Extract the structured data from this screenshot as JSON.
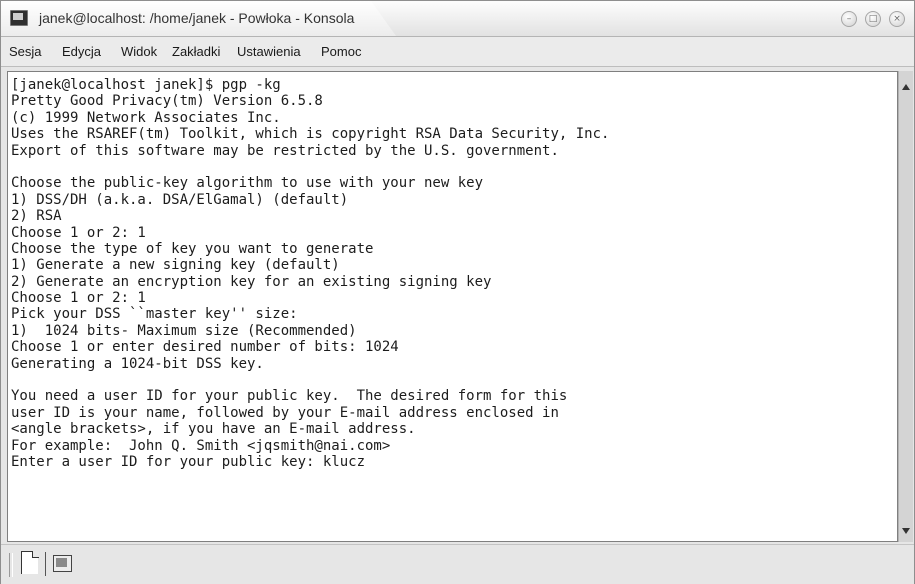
{
  "window": {
    "title": "janek@localhost: /home/janek - Powłoka - Konsola",
    "controls": {
      "minimize": "–",
      "maximize": "□",
      "close": "×"
    }
  },
  "menu": {
    "items": [
      "Sesja",
      "Edycja",
      "Widok",
      "Zakładki",
      "Ustawienia",
      "Pomoc"
    ]
  },
  "terminal": {
    "lines": [
      "[janek@localhost janek]$ pgp -kg",
      "Pretty Good Privacy(tm) Version 6.5.8",
      "(c) 1999 Network Associates Inc.",
      "Uses the RSAREF(tm) Toolkit, which is copyright RSA Data Security, Inc.",
      "Export of this software may be restricted by the U.S. government.",
      "",
      "Choose the public-key algorithm to use with your new key",
      "1) DSS/DH (a.k.a. DSA/ElGamal) (default)",
      "2) RSA",
      "Choose 1 or 2: 1",
      "Choose the type of key you want to generate",
      "1) Generate a new signing key (default)",
      "2) Generate an encryption key for an existing signing key",
      "Choose 1 or 2: 1",
      "Pick your DSS ``master key'' size:",
      "1)  1024 bits- Maximum size (Recommended)",
      "Choose 1 or enter desired number of bits: 1024",
      "Generating a 1024-bit DSS key.",
      "",
      "You need a user ID for your public key.  The desired form for this",
      "user ID is your name, followed by your E-mail address enclosed in",
      "<angle brackets>, if you have an E-mail address.",
      "For example:  John Q. Smith <jqsmith@nai.com>",
      "Enter a user ID for your public key: klucz"
    ]
  },
  "icons": {
    "app": "konsole-icon",
    "new_session": "new-session-icon",
    "terminal": "terminal-icon",
    "scroll_up": "scroll-up-icon",
    "scroll_down": "scroll-down-icon"
  }
}
